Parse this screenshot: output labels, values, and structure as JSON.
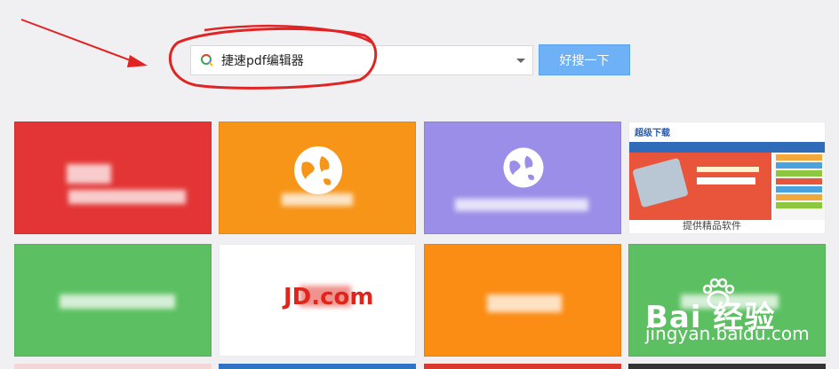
{
  "search": {
    "query": "捷速pdf编辑器",
    "button_label": "好搜一下"
  },
  "tiles": {
    "thumb_logo": "超级下载",
    "thumb_caption": "提供精品软件",
    "jd_label": "JD.com"
  },
  "watermark": {
    "main": "Bai 经验",
    "sub": "jingyan.baidu.com"
  },
  "colors": {
    "red": "#e33535",
    "orange": "#f79518",
    "purple": "#9b8ee8",
    "green": "#5cc062",
    "orange2": "#fb8c14",
    "search_button": "#6fb1f7",
    "annotation": "#e02424"
  }
}
